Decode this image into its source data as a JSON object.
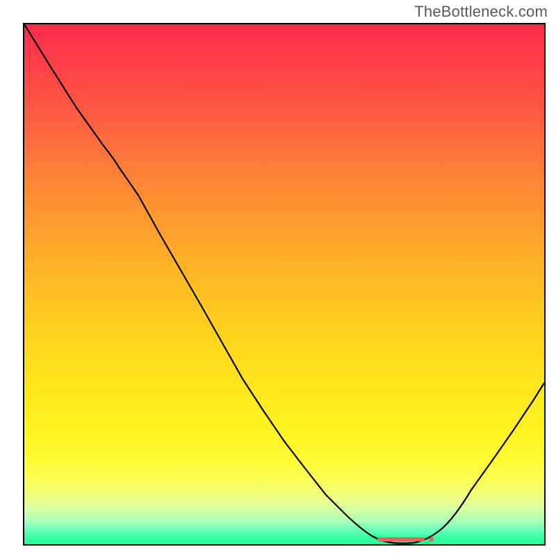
{
  "watermark": "TheBottleneck.com",
  "chart_data": {
    "type": "line",
    "x": [
      0,
      5,
      10,
      15,
      18,
      22,
      26,
      30,
      34,
      38,
      42,
      46,
      50,
      54,
      58,
      62,
      65,
      68,
      71,
      73,
      75,
      78,
      82,
      86,
      90,
      94,
      98,
      100
    ],
    "y": [
      100,
      92,
      84,
      77,
      73,
      67,
      60,
      53,
      46,
      39,
      32,
      26,
      20,
      14.5,
      9.5,
      5.5,
      3,
      1.5,
      0.6,
      0.2,
      0.2,
      0.8,
      3,
      7,
      12.5,
      18.5,
      25,
      28.5
    ],
    "xlim": [
      0,
      100
    ],
    "ylim": [
      0,
      100
    ],
    "xlabel": "",
    "ylabel": "",
    "title": "",
    "grid": false,
    "marker": {
      "x_start": 68,
      "x_end": 77,
      "y": 0.2,
      "color": "#e86460"
    },
    "gradient": {
      "orientation": "vertical",
      "stops": [
        {
          "pos": 0,
          "color": "#ff2b4d"
        },
        {
          "pos": 50,
          "color": "#ffc520"
        },
        {
          "pos": 85,
          "color": "#fffb33"
        },
        {
          "pos": 100,
          "color": "#24ff92"
        }
      ]
    }
  }
}
